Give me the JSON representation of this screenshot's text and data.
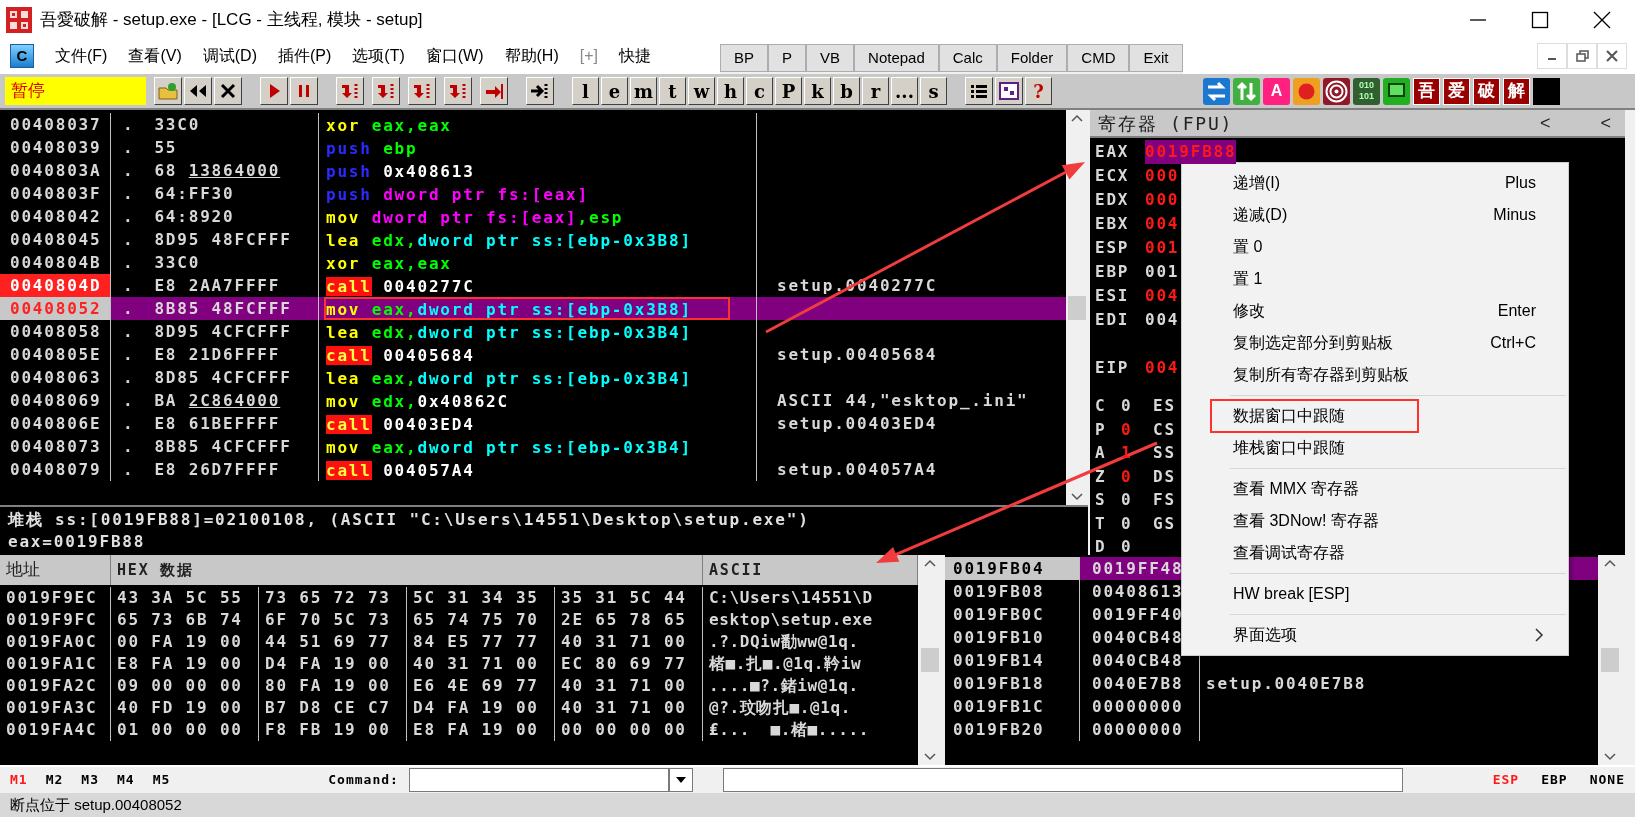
{
  "window": {
    "title": "吾愛破解 - setup.exe - [LCG -  主线程, 模块 - setup]"
  },
  "menu": {
    "logo_letter": "C",
    "items": [
      "文件(F)",
      "查看(V)",
      "调试(D)",
      "插件(P)",
      "选项(T)",
      "窗口(W)",
      "帮助(H)",
      "[+]",
      "快捷"
    ]
  },
  "quick_toolbar": [
    "BP",
    "P",
    "VB",
    "Notepad",
    "Calc",
    "Folder",
    "CMD",
    "Exit"
  ],
  "toolbar": {
    "status": "暂停",
    "letter_buttons": [
      "l",
      "e",
      "m",
      "t",
      "w",
      "h",
      "c",
      "P",
      "k",
      "b",
      "r",
      "...",
      "s"
    ],
    "help": "?",
    "plugin_letter": "A",
    "binary_label": [
      "010",
      "101"
    ],
    "brand_buttons": [
      "吾",
      "爱",
      "破",
      "解"
    ]
  },
  "disassembly": {
    "rows": [
      {
        "address": "00408037",
        "kind": "normal",
        "selected": false,
        "flow": ".",
        "hex": "33C0",
        "tokens": [
          {
            "text": "xor",
            "kind": "op"
          },
          {
            "text": "eax,eax",
            "kind": "reg"
          }
        ]
      },
      {
        "address": "00408039",
        "kind": "normal",
        "selected": false,
        "flow": ".",
        "hex": "55",
        "tokens": [
          {
            "text": "push",
            "kind": "push"
          },
          {
            "text": "ebp",
            "kind": "reg"
          }
        ]
      },
      {
        "address": "0040803A",
        "kind": "normal",
        "selected": false,
        "flow": ".",
        "hex": "68",
        "hex_arg": "13864000",
        "fixup": true,
        "tokens": [
          {
            "text": "push",
            "kind": "push"
          },
          {
            "text": "0x408613",
            "kind": "imm"
          }
        ]
      },
      {
        "address": "0040803F",
        "kind": "normal",
        "selected": false,
        "flow": ".",
        "hex": "64:FF30",
        "tokens": [
          {
            "text": "push",
            "kind": "push"
          },
          {
            "text": "dword ptr fs:[eax]",
            "kind": "seg"
          }
        ]
      },
      {
        "address": "00408042",
        "kind": "normal",
        "selected": false,
        "flow": ".",
        "hex": "64:8920",
        "tokens": [
          {
            "text": "mov",
            "kind": "op"
          },
          {
            "text": "dword ptr fs:[eax]",
            "kind": "seg"
          },
          {
            "text": ",esp",
            "kind": "reg"
          }
        ]
      },
      {
        "address": "00408045",
        "kind": "normal",
        "selected": false,
        "flow": ".",
        "hex": "8D95",
        "hex_arg": "48FCFFF",
        "fixup": false,
        "tokens": [
          {
            "text": "lea",
            "kind": "op"
          },
          {
            "text": "edx,",
            "kind": "reg"
          },
          {
            "text": "dword ptr ss:[ebp-0x3B8]",
            "kind": "mem"
          }
        ]
      },
      {
        "address": "0040804B",
        "kind": "normal",
        "selected": false,
        "flow": ".",
        "hex": "33C0",
        "tokens": [
          {
            "text": "xor",
            "kind": "op"
          },
          {
            "text": "eax,eax",
            "kind": "reg"
          }
        ]
      },
      {
        "address": "0040804D",
        "kind": "breakpoint",
        "selected": false,
        "flow": ".",
        "hex": "E8",
        "hex_arg": "2AA7FFFF",
        "fixup": false,
        "tokens": [
          {
            "text": "call",
            "kind": "call"
          },
          {
            "text": "0040277C",
            "kind": "imm"
          }
        ],
        "comment": "setup.0040277C"
      },
      {
        "address": "00408052",
        "kind": "eip",
        "selected": true,
        "boxed": true,
        "flow": ".",
        "hex": "8B85",
        "hex_arg": "48FCFFF",
        "fixup": false,
        "tokens": [
          {
            "text": "mov",
            "kind": "op"
          },
          {
            "text": "eax,",
            "kind": "reg"
          },
          {
            "text": "dword ptr ss:[ebp-0x3B8]",
            "kind": "mem"
          }
        ]
      },
      {
        "address": "00408058",
        "kind": "normal",
        "selected": false,
        "flow": ".",
        "hex": "8D95",
        "hex_arg": "4CFCFFF",
        "fixup": false,
        "tokens": [
          {
            "text": "lea",
            "kind": "op"
          },
          {
            "text": "edx,",
            "kind": "reg"
          },
          {
            "text": "dword ptr ss:[ebp-0x3B4]",
            "kind": "mem"
          }
        ]
      },
      {
        "address": "0040805E",
        "kind": "normal",
        "selected": false,
        "flow": ".",
        "hex": "E8",
        "hex_arg": "21D6FFFF",
        "fixup": false,
        "tokens": [
          {
            "text": "call",
            "kind": "call"
          },
          {
            "text": "00405684",
            "kind": "imm"
          }
        ],
        "comment": "setup.00405684"
      },
      {
        "address": "00408063",
        "kind": "normal",
        "selected": false,
        "flow": ".",
        "hex": "8D85",
        "hex_arg": "4CFCFFF",
        "fixup": false,
        "tokens": [
          {
            "text": "lea",
            "kind": "op"
          },
          {
            "text": "eax,",
            "kind": "reg"
          },
          {
            "text": "dword ptr ss:[ebp-0x3B4]",
            "kind": "mem"
          }
        ]
      },
      {
        "address": "00408069",
        "kind": "normal",
        "selected": false,
        "flow": ".",
        "hex": "BA",
        "hex_arg": "2C864000",
        "fixup": true,
        "tokens": [
          {
            "text": "mov",
            "kind": "op"
          },
          {
            "text": "edx,",
            "kind": "reg"
          },
          {
            "text": "0x40862C",
            "kind": "imm"
          }
        ],
        "comment": "ASCII 44,\"esktop_.ini\""
      },
      {
        "address": "0040806E",
        "kind": "normal",
        "selected": false,
        "flow": ".",
        "hex": "E8",
        "hex_arg": "61BEFFFF",
        "fixup": false,
        "tokens": [
          {
            "text": "call",
            "kind": "call"
          },
          {
            "text": "00403ED4",
            "kind": "imm"
          }
        ],
        "comment": "setup.00403ED4"
      },
      {
        "address": "00408073",
        "kind": "normal",
        "selected": false,
        "flow": ".",
        "hex": "8B85",
        "hex_arg": "4CFCFFF",
        "fixup": false,
        "tokens": [
          {
            "text": "mov",
            "kind": "op"
          },
          {
            "text": "eax,",
            "kind": "reg"
          },
          {
            "text": "dword ptr ss:[ebp-0x3B4]",
            "kind": "mem"
          }
        ]
      },
      {
        "address": "00408079",
        "kind": "normal",
        "selected": false,
        "flow": ".",
        "hex": "E8",
        "hex_arg": "26D7FFFF",
        "fixup": false,
        "tokens": [
          {
            "text": "call",
            "kind": "call"
          },
          {
            "text": "004057A4",
            "kind": "imm"
          }
        ],
        "comment": "setup.004057A4"
      }
    ]
  },
  "info": [
    "堆栈 ss:[0019FB88]=02100108, (ASCII \"C:\\Users\\14551\\Desktop\\setup.exe\")",
    "eax=0019FB88"
  ],
  "registers": {
    "title": "寄存器 (FPU)",
    "nav": [
      "<",
      "<"
    ],
    "general": [
      {
        "name": "EAX",
        "value": "0019FB88",
        "changed": true,
        "selected": true
      },
      {
        "name": "ECX",
        "value": "000",
        "changed": true,
        "selected": false
      },
      {
        "name": "EDX",
        "value": "000",
        "changed": true,
        "selected": false
      },
      {
        "name": "EBX",
        "value": "004",
        "changed": true,
        "selected": false
      },
      {
        "name": "ESP",
        "value": "001",
        "changed": true,
        "selected": false
      },
      {
        "name": "EBP",
        "value": "001",
        "changed": false,
        "selected": false
      },
      {
        "name": "ESI",
        "value": "004",
        "changed": true,
        "selected": false
      },
      {
        "name": "EDI",
        "value": "004",
        "changed": false,
        "selected": false
      }
    ],
    "eip": {
      "name": "EIP",
      "value": "004",
      "changed": true,
      "selected": false
    },
    "flags": [
      {
        "flag": "C",
        "value": "0",
        "changed": false,
        "segment": "ES"
      },
      {
        "flag": "P",
        "value": "0",
        "changed": true,
        "segment": "CS"
      },
      {
        "flag": "A",
        "value": "1",
        "changed": true,
        "segment": "SS"
      },
      {
        "flag": "Z",
        "value": "0",
        "changed": true,
        "segment": "DS"
      },
      {
        "flag": "S",
        "value": "0",
        "changed": false,
        "segment": "FS"
      },
      {
        "flag": "T",
        "value": "0",
        "changed": false,
        "segment": "GS"
      },
      {
        "flag": "D",
        "value": "0",
        "changed": false
      }
    ]
  },
  "dump": {
    "columns": [
      "地址",
      "HEX 数据",
      "ASCII"
    ],
    "rows": [
      {
        "address": "0019F9EC",
        "bytes": [
          "43 3A 5C 55",
          "73 65 72 73",
          "5C 31 34 35",
          "35 31 5C 44"
        ],
        "ascii": "C:\\Users\\14551\\D"
      },
      {
        "address": "0019F9FC",
        "bytes": [
          "65 73 6B 74",
          "6F 70 5C 73",
          "65 74 75 70",
          "2E 65 78 65"
        ],
        "ascii": "esktop\\setup.exe"
      },
      {
        "address": "0019FA0C",
        "bytes": [
          "00 FA 19 00",
          "44 51 69 77",
          "84 E5 77 77",
          "40 31 71 00"
        ],
        "ascii": ".?.DQiw勫ww@1q."
      },
      {
        "address": "0019FA1C",
        "bytes": [
          "E8 FA 19 00",
          "D4 FA 19 00",
          "40 31 71 00",
          "EC 80 69 77"
        ],
        "ascii": "楮■.扎■.@1q.靲iw"
      },
      {
        "address": "0019FA2C",
        "bytes": [
          "09 00 00 00",
          "80 FA 19 00",
          "E6 4E 69 77",
          "40 31 71 00"
        ],
        "ascii": "....■?.鍺iw@1q."
      },
      {
        "address": "0019FA3C",
        "bytes": [
          "40 FD 19 00",
          "B7 D8 CE C7",
          "D4 FA 19 00",
          "40 31 71 00"
        ],
        "ascii": "@?.玟吻扎■.@1q."
      },
      {
        "address": "0019FA4C",
        "bytes": [
          "01 00 00 00",
          "F8 FB 19 00",
          "E8 FA 19 00",
          "00 00 00 00"
        ],
        "ascii": "₤...  ■.楮■....."
      }
    ]
  },
  "stack": {
    "rows": [
      {
        "address": "0019FB04",
        "value": "0019FF48",
        "selected": true
      },
      {
        "address": "0019FB08",
        "value": "00408613",
        "selected": false
      },
      {
        "address": "0019FB0C",
        "value": "0019FF40",
        "selected": false
      },
      {
        "address": "0019FB10",
        "value": "0040CB48",
        "selected": false
      },
      {
        "address": "0019FB14",
        "value": "0040CB48",
        "selected": false
      },
      {
        "address": "0019FB18",
        "value": "0040E7B8",
        "selected": false,
        "comment": "setup.0040E7B8"
      },
      {
        "address": "0019FB1C",
        "value": "00000000",
        "selected": false
      },
      {
        "address": "0019FB20",
        "value": "00000000",
        "selected": false
      }
    ]
  },
  "context_menu": {
    "items": [
      {
        "kind": "item",
        "label": "递增(I)",
        "shortcut": "Plus"
      },
      {
        "kind": "item",
        "label": "递减(D)",
        "shortcut": "Minus"
      },
      {
        "kind": "item",
        "label": "置 0"
      },
      {
        "kind": "item",
        "label": "置 1"
      },
      {
        "kind": "item",
        "label": "修改",
        "shortcut": "Enter"
      },
      {
        "kind": "item",
        "label": "复制选定部分到剪贴板",
        "shortcut": "Ctrl+C"
      },
      {
        "kind": "item",
        "label": "复制所有寄存器到剪贴板"
      },
      {
        "kind": "separator"
      },
      {
        "kind": "item",
        "label": "数据窗口中跟随",
        "boxed": true
      },
      {
        "kind": "item",
        "label": "堆栈窗口中跟随"
      },
      {
        "kind": "separator"
      },
      {
        "kind": "item",
        "label": "查看 MMX 寄存器"
      },
      {
        "kind": "item",
        "label": "查看 3DNow! 寄存器"
      },
      {
        "kind": "item",
        "label": "查看调试寄存器"
      },
      {
        "kind": "separator"
      },
      {
        "kind": "item",
        "label": "HW break [ESP]"
      },
      {
        "kind": "separator"
      },
      {
        "kind": "item",
        "label": "界面选项",
        "submenu": true
      }
    ]
  },
  "command_bar": {
    "memory_tabs": [
      {
        "label": "M1",
        "selected": true
      },
      {
        "label": "M2",
        "selected": false
      },
      {
        "label": "M3",
        "selected": false
      },
      {
        "label": "M4",
        "selected": false
      },
      {
        "label": "M5",
        "selected": false
      }
    ],
    "command_label": "Command:",
    "stack_tabs": [
      {
        "label": "ESP",
        "selected": true
      },
      {
        "label": "EBP",
        "selected": false
      },
      {
        "label": "NONE",
        "selected": false
      }
    ]
  },
  "status_bar": "断点位于 setup.00408052"
}
